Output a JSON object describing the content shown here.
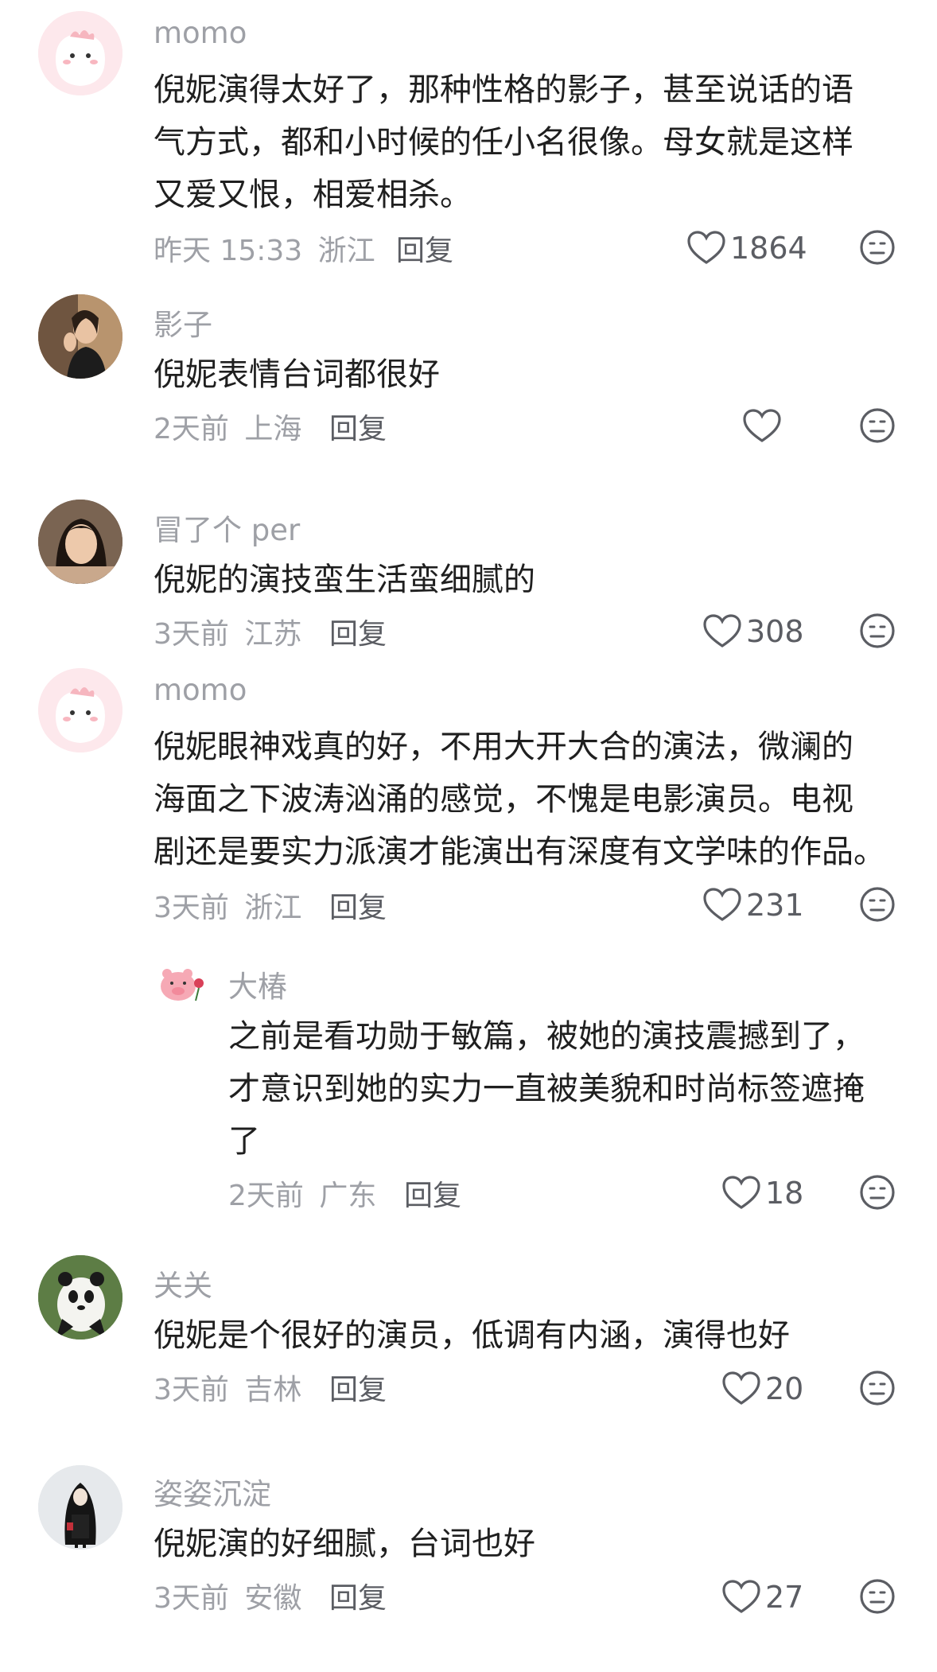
{
  "comments": [
    {
      "username": "momo",
      "lines": [
        "倪妮演得太好了，那种性格的影子，甚至说话的语",
        "气方式，都和小时候的任小名很像。母女就是这样",
        "又爱又恨，相爱相杀。"
      ],
      "time": "昨天 15:33",
      "location": "浙江",
      "reply_label": "回复",
      "likes": "1864",
      "avatar": "pink-cartoon-avatar"
    },
    {
      "username": "影子",
      "lines": [
        "倪妮表情台词都很好"
      ],
      "time": "2天前",
      "location": "上海",
      "reply_label": "回复",
      "likes": "",
      "avatar": "photo-avatar-woman"
    },
    {
      "username": "冒了个 per",
      "lines": [
        "倪妮的演技蛮生活蛮细腻的"
      ],
      "time": "3天前",
      "location": "江苏",
      "reply_label": "回复",
      "likes": "308",
      "avatar": "photo-avatar-actress"
    },
    {
      "username": "momo",
      "lines": [
        "倪妮眼神戏真的好，不用大开大合的演法，微澜的",
        "海面之下波涛汹涌的感觉，不愧是电影演员。电视",
        "剧还是要实力派演才能演出有深度有文学味的作品。"
      ],
      "time": "3天前",
      "location": "浙江",
      "reply_label": "回复",
      "likes": "231",
      "avatar": "pink-cartoon-avatar"
    },
    {
      "username": "大椿",
      "lines": [
        "之前是看功勋于敏篇，被她的演技震撼到了，",
        "才意识到她的实力一直被美貌和时尚标签遮掩",
        "了"
      ],
      "time": "2天前",
      "location": "广东",
      "reply_label": "回复",
      "likes": "18",
      "avatar": "pig-cartoon-avatar"
    },
    {
      "username": "关关",
      "lines": [
        "倪妮是个很好的演员，低调有内涵，演得也好"
      ],
      "time": "3天前",
      "location": "吉林",
      "reply_label": "回复",
      "likes": "20",
      "avatar": "panda-photo-avatar"
    },
    {
      "username": "姿姿沉淀",
      "lines": [
        "倪妮演的好细腻，台词也好"
      ],
      "time": "3天前",
      "location": "安徽",
      "reply_label": "回复",
      "likes": "27",
      "avatar": "figure-illustration-avatar"
    }
  ],
  "colors": {
    "meta": "#9ea0a6",
    "text": "#1f1f1f",
    "icon": "#5b5d63"
  }
}
